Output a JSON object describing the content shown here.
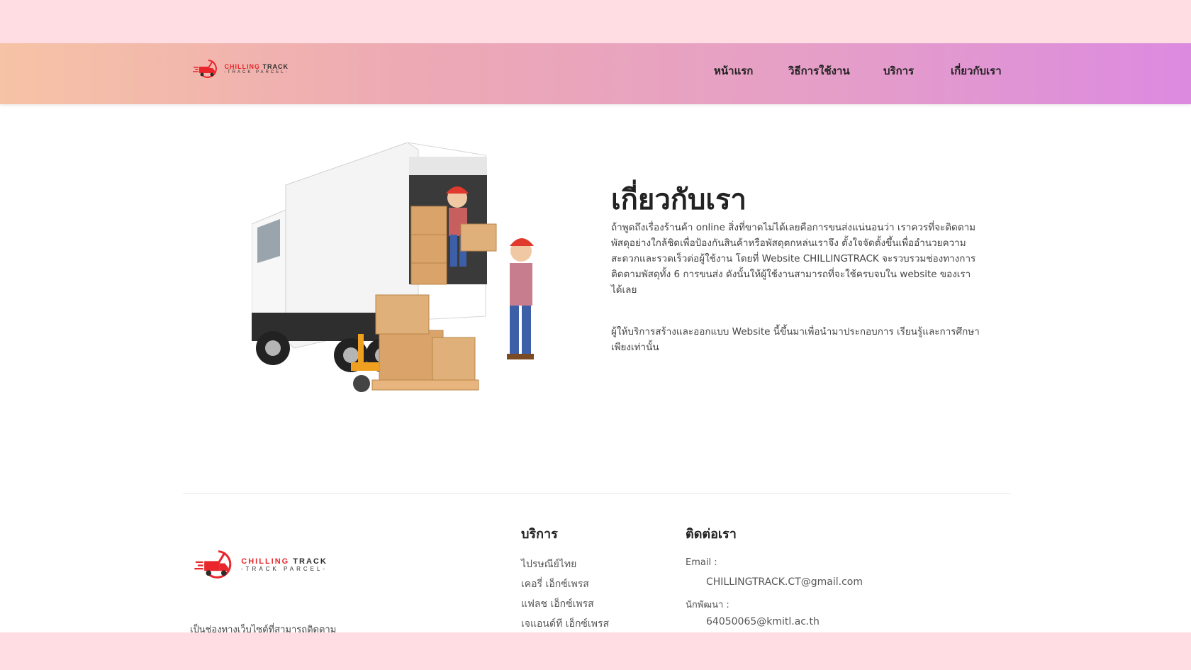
{
  "brand": {
    "logo_title_red": "CHILLING",
    "logo_title_dark": "TRACK",
    "logo_subtitle": "-TRACK PARCEL-",
    "accent_color": "#e8262b"
  },
  "nav": {
    "items": [
      {
        "label": "หน้าแรก"
      },
      {
        "label": "วิธีการใช้งาน"
      },
      {
        "label": "บริการ"
      },
      {
        "label": "เกี่ยวกับเรา"
      }
    ]
  },
  "about": {
    "title": "เกี่ยวกับเรา",
    "paragraph1": "ถ้าพูดถึงเรื่องร้านค้า online สิ่งที่ขาดไม่ได้เลยคือการขนส่งแน่นอนว่า เราควรที่จะติดตามพัสดุอย่างใกล้ชิดเพื่อป้องกันสินค้าหรือพัสดุตกหล่นเราจึง ตั้งใจจัดตั้งขึ้นเพื่ออำนวยความสะดวกและรวดเร็วต่อผู้ใช้งาน โดยที่ Website CHILLINGTRACK จะรวบรวมช่องทางการติดตามพัสดุทั้ง 6 การขนส่ง ดังนั้นให้ผู้ใช้งานสามารถที่จะใช้ครบจบใน website ของเราได้เลย",
    "paragraph2": "ผู้ให้บริการสร้างและออกแบบ Website นี้ขึ้นมาเพื่อนำมาประกอบการ เรียนรู้และการศึกษาเพียงเท่านั้น"
  },
  "footer": {
    "description": "เป็นช่องทางเว็บไซต์ที่สามารถติดตาม",
    "services_heading": "บริการ",
    "services": [
      {
        "label": "ไปรษณีย์ไทย"
      },
      {
        "label": "เคอรี่ เอ็กซ์เพรส"
      },
      {
        "label": "แฟลช เอ็กซ์เพรส"
      },
      {
        "label": "เจแอนด์ที เอ็กซ์เพรส"
      }
    ],
    "contact_heading": "ติดต่อเรา",
    "email_label": "Email :",
    "email_value": "CHILLINGTRACK.CT@gmail.com",
    "developer_label": "นักพัฒนา :",
    "developer_value": "64050065@kmitl.ac.th"
  }
}
